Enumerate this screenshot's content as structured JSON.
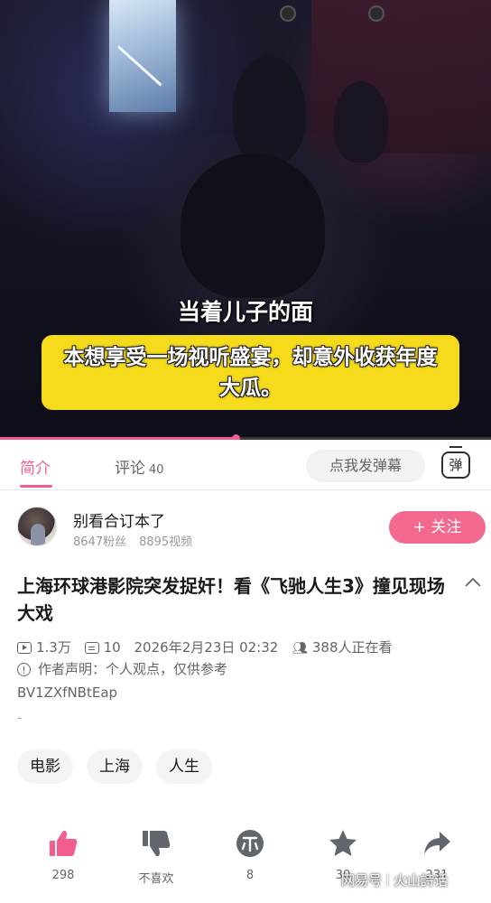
{
  "video": {
    "caption_top": "当着儿子的面",
    "caption_box": "本想享受一场视听盛宴，却意外收获年度大瓜。",
    "progress_fraction": 0.48
  },
  "tabs": {
    "intro": "简介",
    "comments": "评论",
    "comments_count": "40",
    "danmaku_placeholder": "点我发弹幕",
    "danmaku_toggle": "弹"
  },
  "uploader": {
    "name": "别看合订本了",
    "followers": "8647粉丝",
    "videos": "8895视频",
    "follow_label": "+ 关注"
  },
  "video_info": {
    "title": "上海环球港影院突发捉奸！看《飞驰人生3》撞见现场大戏",
    "views": "1.3万",
    "danmaku_count": "10",
    "publish_time": "2026年2月23日 02:32",
    "watching_now": "388人正在看",
    "statement": "作者声明：个人观点，仅供参考",
    "bvid": "BV1ZXfNBtEap",
    "dash": "-"
  },
  "tags": [
    "电影",
    "上海",
    "人生"
  ],
  "actions": [
    {
      "icon": "thumbs-up-icon",
      "label": "298"
    },
    {
      "icon": "thumbs-down-icon",
      "label": "不喜欢"
    },
    {
      "icon": "coin-icon",
      "label": "8"
    },
    {
      "icon": "star-icon",
      "label": "30"
    },
    {
      "icon": "share-icon",
      "label": "231"
    }
  ],
  "watermark": {
    "left": "网易号",
    "right": "火山詩话"
  },
  "colors": {
    "accent": "#f25d8e",
    "caption_yellow": "#f6db1d"
  }
}
